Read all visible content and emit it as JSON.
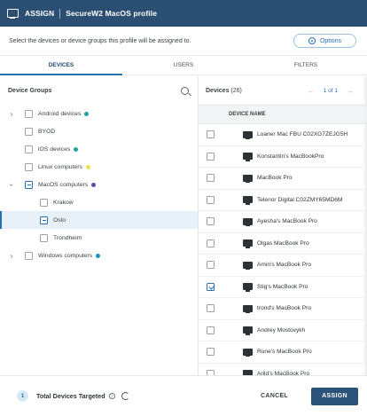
{
  "header": {
    "assign_label": "ASSIGN",
    "title": "SecureW2 MacOS profile"
  },
  "subheader": {
    "description": "Select the devices or device groups this profile will be assigned to.",
    "options_label": "Options"
  },
  "tabs": [
    {
      "label": "DEVICES"
    },
    {
      "label": "USERS"
    },
    {
      "label": "FILTERS"
    }
  ],
  "left": {
    "title": "Device Groups",
    "groups": [
      {
        "label": "Android devices",
        "dot": "#1aa6a0"
      },
      {
        "label": "BYOD",
        "dot": ""
      },
      {
        "label": "iOS devices",
        "dot": "#1aa6a0"
      },
      {
        "label": "Linux computers",
        "dot": "#f2e24a"
      },
      {
        "label": "MacOS computers",
        "dot": "#5b4fa8"
      },
      {
        "label": "Krakow"
      },
      {
        "label": "Oslo"
      },
      {
        "label": "Trondheim"
      },
      {
        "label": "Windows computers",
        "dot": "#1a8fc6"
      }
    ]
  },
  "right": {
    "title": "Devices",
    "count": "(26)",
    "pager_text": "1 of 1",
    "col_header": "DEVICE NAME",
    "devices": [
      {
        "name": "Loaner Mac FBU C02XG7ZEJG5H",
        "checked": false
      },
      {
        "name": "Konstantin's MacBookPro",
        "checked": false
      },
      {
        "name": "MacBook Pro",
        "checked": false
      },
      {
        "name": "Telenor Digital C02ZMY65MD6M",
        "checked": false
      },
      {
        "name": "Ayesha's MacBook Pro",
        "checked": false
      },
      {
        "name": "Olgas MacBook Pro",
        "checked": false
      },
      {
        "name": "Amin's MacBook Pro",
        "checked": false
      },
      {
        "name": "Stig's MacBook Pro",
        "checked": true
      },
      {
        "name": "trond's MacBook Pro",
        "checked": false
      },
      {
        "name": "Andrey Mostovykh",
        "checked": false
      },
      {
        "name": "Rune's MacBook Pro",
        "checked": false
      },
      {
        "name": "Arild's MacBook Pro",
        "checked": false
      }
    ]
  },
  "footer": {
    "count": "1",
    "total_label": "Total Devices Targeted",
    "cancel_label": "CANCEL",
    "assign_label": "ASSIGN"
  }
}
